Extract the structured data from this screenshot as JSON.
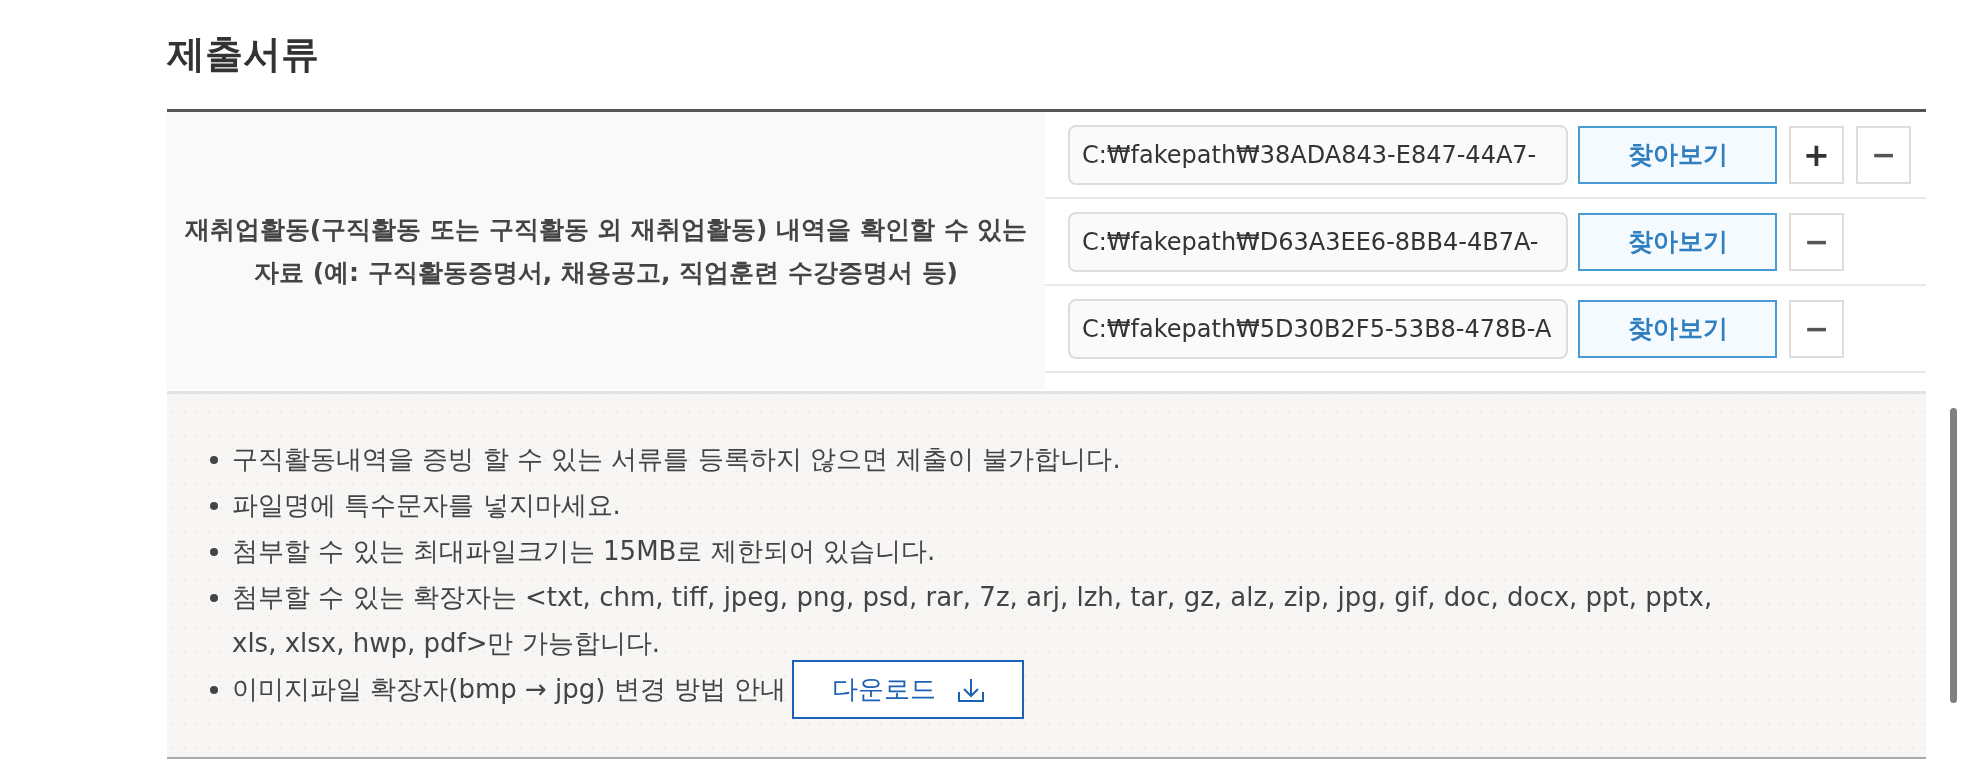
{
  "section": {
    "title": "제출서류"
  },
  "document": {
    "label": "재취업활동(구직활동 또는 구직활동 외 재취업활동) 내역을 확인할 수 있는 자료 (예: 구직활동증명서, 채용공고, 직업훈련 수강증명서 등)",
    "files": [
      {
        "path": "C:₩fakepath₩38ADA843-E847-44A7-",
        "browse_button": "찾아보기",
        "actions": [
          {
            "kind": "add",
            "label": "+"
          },
          {
            "kind": "remove",
            "label": "−"
          }
        ]
      },
      {
        "path": "C:₩fakepath₩D63A3EE6-8BB4-4B7A-",
        "browse_button": "찾아보기",
        "actions": [
          {
            "kind": "remove",
            "label": "−"
          }
        ]
      },
      {
        "path": "C:₩fakepath₩5D30B2F5-53B8-478B-A",
        "browse_button": "찾아보기",
        "actions": [
          {
            "kind": "remove",
            "label": "−"
          }
        ]
      }
    ]
  },
  "notes": {
    "items": [
      {
        "text": "구직활동내역을 증빙 할 수 있는 서류를 등록하지 않으면 제출이 불가합니다."
      },
      {
        "text": "파일명에 특수문자를 넣지마세요."
      },
      {
        "text": "첨부할 수 있는 최대파일크기는 15MB로 제한되어 있습니다."
      },
      {
        "text": "첨부할 수 있는 확장자는 <txt, chm, tiff, jpeg, png, psd, rar, 7z, arj, lzh, tar, gz, alz, zip, jpg, gif, doc, docx, ppt, pptx, xls, xlsx, hwp, pdf>만 가능합니다."
      },
      {
        "text": "이미지파일 확장자(bmp → jpg) 변경 방법 안내",
        "button": {
          "label": "다운로드"
        }
      }
    ]
  }
}
